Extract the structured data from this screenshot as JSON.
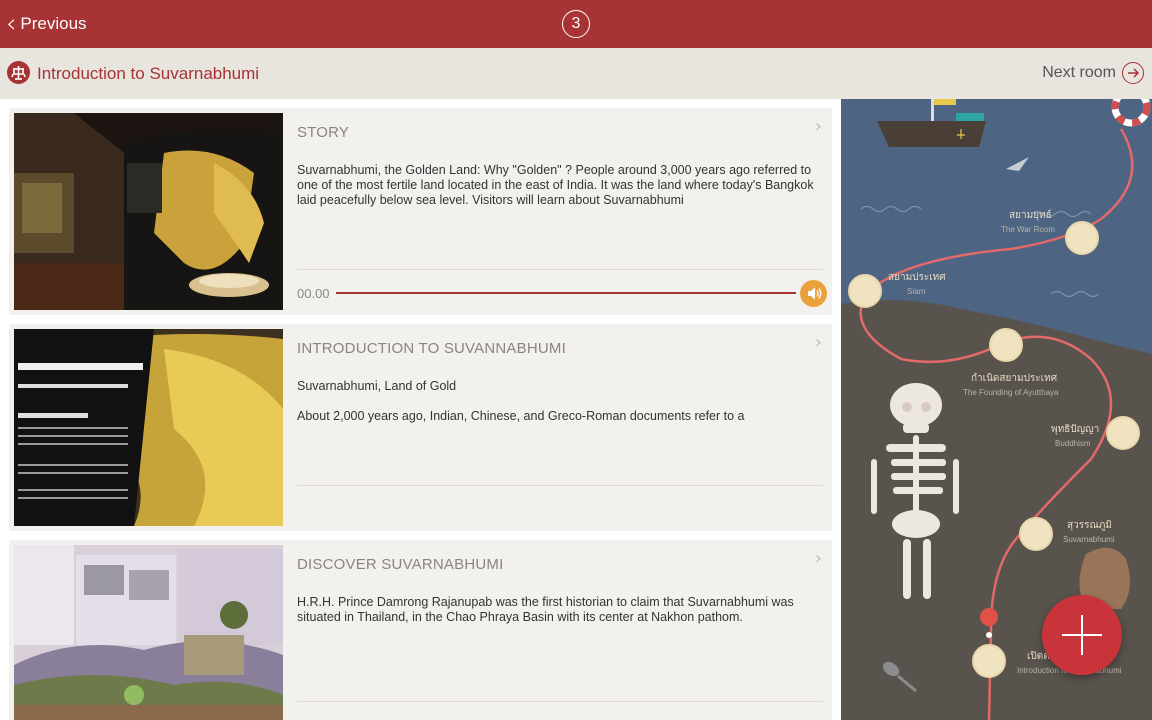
{
  "topbar": {
    "previous_label": "Previous",
    "room_number": "3"
  },
  "subbar": {
    "room_title": "Introduction to Suvarnabhumi",
    "next_room_label": "Next room"
  },
  "cards": [
    {
      "title": "STORY",
      "body": [
        "Suvarnabhumi, the Golden Land: Why \"Golden\" ? People around 3,000 years ago referred to one of the most fertile land located in the east of India. It was the land where today's Bangkok laid peacefully below sea level. Visitors will learn about Suvarnabhumi"
      ],
      "audio_time": "00.00"
    },
    {
      "title": "INTRODUCTION TO SUVANNABHUMI",
      "body": [
        "Suvarnabhumi, Land of Gold",
        "About 2,000 years ago, Indian, Chinese, and Greco-Roman documents refer to a"
      ]
    },
    {
      "title": "DISCOVER SUVARNABHUMI",
      "body": [
        "H.R.H. Prince Damrong Rajanupab was the first historian to claim that Suvarnabhumi was situated in Thailand, in the Chao Phraya Basin with its center at Nakhon pathom."
      ]
    }
  ],
  "map": {
    "labels": [
      {
        "th": "สยามยุทธ์",
        "en": "The War Room"
      },
      {
        "th": "สยามประเทศ",
        "en": "Siam"
      },
      {
        "th": "กำเนิดสยามประเทศ",
        "en": "The Founding of Ayutthaya"
      },
      {
        "th": "พุทธิปัญญา",
        "en": "Buddhism"
      },
      {
        "th": "สุวรรณภูมิ",
        "en": "Suvarnabhumi"
      },
      {
        "th": "เปิดตำ",
        "en": "Introduction to Suvarnabhumi"
      }
    ]
  },
  "colors": {
    "brand_red": "#a73335",
    "audio_orange": "#e9a23b",
    "sea": "#4d6483",
    "land": "#59534d",
    "path": "#e26a6a"
  }
}
